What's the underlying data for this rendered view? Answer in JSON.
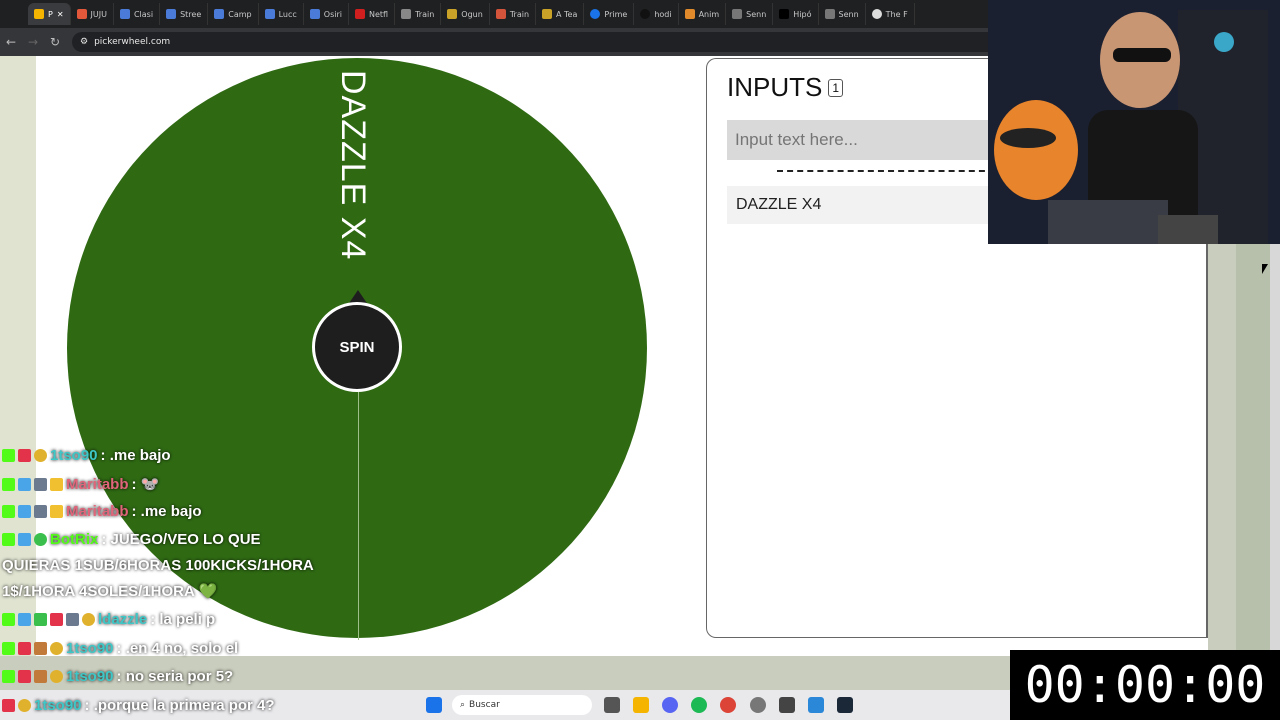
{
  "browser": {
    "tabs": [
      {
        "label": "P",
        "active": true
      },
      {
        "label": "JUJU"
      },
      {
        "label": "Clasi"
      },
      {
        "label": "Stree"
      },
      {
        "label": "Camp"
      },
      {
        "label": "Lucc"
      },
      {
        "label": "Osiri"
      },
      {
        "label": "Netfl"
      },
      {
        "label": "Train"
      },
      {
        "label": "Ogun"
      },
      {
        "label": "Train"
      },
      {
        "label": "A Tea"
      },
      {
        "label": "Prime"
      },
      {
        "label": "hodi"
      },
      {
        "label": "Anim"
      },
      {
        "label": "Senn"
      },
      {
        "label": "Hipó"
      },
      {
        "label": "Senn"
      },
      {
        "label": "The F"
      }
    ],
    "url": "pickerwheel.com"
  },
  "wheel": {
    "segment_label": "DAZZLE X4",
    "spin_label": "SPIN",
    "color": "#2f6a13"
  },
  "panel": {
    "title": "INPUTS",
    "count": "1",
    "input_placeholder": "Input text here...",
    "entries": [
      "DAZZLE X4"
    ]
  },
  "chat": [
    {
      "user": "1tso90",
      "text": ": .me bajo"
    },
    {
      "user": "Maritabb",
      "text": ": 🐭"
    },
    {
      "user": "Maritabb",
      "text": ": .me bajo"
    },
    {
      "user": "BotRix",
      "text": ": JUEGO/VEO LO QUE"
    },
    {
      "user": "",
      "text": "QUIERAS 1SUB/6HORAS 100KICKS/1HORA"
    },
    {
      "user": "",
      "text": "1$/1HORA 4SOLES/1HORA 💚"
    },
    {
      "user": "ldazzle",
      "text": ": la peli p"
    },
    {
      "user": "1tso90",
      "text": ": .en 4 no, solo el"
    },
    {
      "user": "1tso90",
      "text": ": no seria por 5?"
    },
    {
      "user": "1tso90",
      "text": ": .porque la primera por 4?"
    }
  ],
  "taskbar": {
    "search_label": "Buscar"
  },
  "timer": "00:00:00"
}
